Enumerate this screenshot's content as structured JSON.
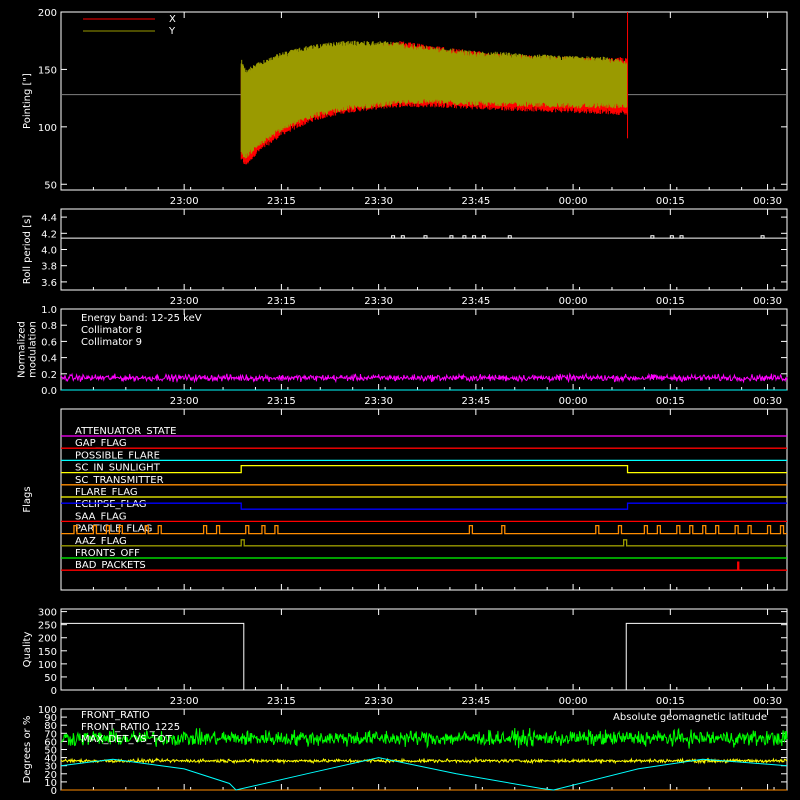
{
  "time_axis": {
    "unit": "HH:MM",
    "range_minutes": [
      -19,
      93
    ],
    "ticks": [
      {
        "m": 0,
        "label": "23:00"
      },
      {
        "m": 15,
        "label": "23:15"
      },
      {
        "m": 30,
        "label": "23:30"
      },
      {
        "m": 45,
        "label": "23:45"
      },
      {
        "m": 60,
        "label": "00:00"
      },
      {
        "m": 75,
        "label": "00:15"
      },
      {
        "m": 90,
        "label": "00:30"
      }
    ],
    "data_gap_minutes": [
      8.8,
      68.4
    ]
  },
  "colors": {
    "white": "#ffffff",
    "red": "#ff0000",
    "olive": "#9a9a00",
    "cyan": "#00ffff",
    "magenta": "#ff00ff",
    "gray": "#808080",
    "green": "#00ff00",
    "yellow": "#ffff00",
    "orange": "#ff8c00",
    "blue": "#0000ff",
    "brightgreen": "#33ff33"
  },
  "chart_data": [
    {
      "type": "line",
      "name": "pointing",
      "ylabel": "Pointing [\"]",
      "ylim": [
        45,
        200
      ],
      "yticks": [
        50,
        100,
        150,
        200
      ],
      "reference_line": 128,
      "legend": {
        "placement": "top-left",
        "entries": [
          {
            "label": "X",
            "color": "red"
          },
          {
            "label": "Y",
            "color": "olive"
          }
        ]
      },
      "series": [
        {
          "name": "X",
          "color": "red",
          "envelope_x_minutes": [
            8.8,
            9.5,
            11,
            15,
            20,
            25,
            30,
            33,
            38,
            45,
            50,
            55,
            60,
            65,
            68.4
          ],
          "upper": [
            155,
            146,
            151,
            158,
            165,
            170,
            172,
            175,
            171,
            166,
            163,
            162,
            161,
            160,
            161
          ],
          "lower": [
            70,
            65,
            75,
            92,
            105,
            112,
            115,
            117,
            117,
            115,
            114,
            113,
            112,
            111,
            110
          ]
        },
        {
          "name": "Y",
          "color": "olive",
          "envelope_x_minutes": [
            8.8,
            9.5,
            11,
            15,
            20,
            25,
            30,
            33,
            38,
            45,
            50,
            55,
            60,
            65,
            68.4
          ],
          "upper": [
            160,
            150,
            155,
            165,
            172,
            175,
            175,
            174,
            170,
            166,
            165,
            163,
            162,
            161,
            158
          ],
          "lower": [
            75,
            72,
            80,
            96,
            108,
            114,
            117,
            119,
            120,
            118,
            118,
            117,
            116,
            116,
            116
          ]
        }
      ]
    },
    {
      "type": "line",
      "name": "roll",
      "ylabel": "Roll period [s]",
      "ylim": [
        3.5,
        4.5
      ],
      "yticks": [
        3.6,
        3.8,
        4.0,
        4.2,
        4.4
      ],
      "series": [
        {
          "name": "",
          "color": "white",
          "baseline": 4.14,
          "blips_minutes": [
            32,
            33.5,
            37,
            41,
            43,
            44.5,
            46,
            50,
            72,
            75,
            76.5,
            89
          ]
        }
      ]
    },
    {
      "type": "line",
      "name": "modulation",
      "ylabel_lines": [
        "Normalized",
        "modulation"
      ],
      "ylim": [
        0,
        1
      ],
      "yticks": [
        0.0,
        0.2,
        0.4,
        0.6,
        0.8,
        1.0
      ],
      "legend": {
        "placement": "top-left",
        "entries": [
          {
            "label": "Energy band: 12-25 keV",
            "color": "white"
          },
          {
            "label": "Collimator 8",
            "color": "cyan"
          },
          {
            "label": "Collimator 9",
            "color": "magenta"
          }
        ]
      },
      "series": [
        {
          "name": "Collimator 9",
          "color": "magenta",
          "mean": 0.15,
          "spread": 0.06
        },
        {
          "name": "Collimator 8",
          "color": "cyan",
          "mean": 0.0,
          "spread": 0.0
        }
      ]
    },
    {
      "type": "step",
      "name": "flags",
      "ylabel": "Flags",
      "flags": [
        {
          "label": "ATTENUATOR_STATE",
          "color": "magenta",
          "mode": "flat"
        },
        {
          "label": "GAP_FLAG",
          "color": "red",
          "mode": "flat"
        },
        {
          "label": "POSSIBLE_FLARE",
          "color": "cyan",
          "mode": "flat"
        },
        {
          "label": "SC_IN_SUNLIGHT",
          "color": "yellow",
          "mode": "sunlight"
        },
        {
          "label": "SC_TRANSMITTER",
          "color": "orange",
          "mode": "flat"
        },
        {
          "label": "FLARE_FLAG",
          "color": "yellow",
          "mode": "flat"
        },
        {
          "label": "ECLIPSE_FLAG",
          "color": "blue",
          "mode": "eclipse"
        },
        {
          "label": "SAA_FLAG",
          "color": "red",
          "mode": "flat"
        },
        {
          "label": "PARTICLE_FLAG",
          "color": "orange",
          "mode": "particle",
          "pulses_minutes": [
            -17,
            -14,
            -12,
            -10,
            -6,
            -4,
            3,
            5,
            9.5,
            12,
            14,
            44,
            49,
            63.5,
            67,
            71,
            73,
            76,
            78,
            80,
            82,
            85,
            87,
            90,
            92
          ]
        },
        {
          "label": "AAZ_FLAG",
          "color": "olive",
          "mode": "aaz",
          "pulses_minutes": [
            8.8,
            67.8
          ]
        },
        {
          "label": "FRONTS_OFF",
          "color": "green",
          "mode": "flat"
        },
        {
          "label": "BAD_PACKETS",
          "color": "red",
          "mode": "badpackets",
          "pulses_minutes": [
            85.4
          ]
        }
      ]
    },
    {
      "type": "step",
      "name": "quality",
      "ylabel": "Quality",
      "ylim": [
        0,
        310
      ],
      "yticks": [
        0,
        50,
        100,
        150,
        200,
        250,
        300
      ],
      "series": [
        {
          "name": "",
          "color": "white",
          "steps": [
            {
              "m": -19,
              "v": 255
            },
            {
              "m": 9.2,
              "v": 0
            },
            {
              "m": 68.2,
              "v": 255
            }
          ]
        }
      ]
    },
    {
      "type": "line",
      "name": "degrees",
      "ylabel": "Degrees or %",
      "ylim": [
        0,
        100
      ],
      "yticks": [
        0,
        10,
        20,
        30,
        40,
        50,
        60,
        70,
        80,
        90,
        100
      ],
      "legend": {
        "placement": "top-left",
        "entries": [
          {
            "label": "FRONT_RATIO",
            "color": "yellow"
          },
          {
            "label": "FRONT_RATIO_1225",
            "color": "green"
          },
          {
            "label": "MAX_DET_VS_TOT",
            "color": "orange"
          }
        ]
      },
      "annotation": {
        "label": "Absolute geomagnetic latitude",
        "color": "cyan",
        "placement": "top-right"
      },
      "series": [
        {
          "name": "FRONT_RATIO_1225",
          "color": "green",
          "mean": 64,
          "spread": 14
        },
        {
          "name": "FRONT_RATIO",
          "color": "yellow",
          "mean": 36,
          "spread": 3
        },
        {
          "name": "MAX_DET_VS_TOT",
          "color": "orange",
          "mean": 0,
          "spread": 0
        },
        {
          "name": "Absolute geomagnetic latitude",
          "color": "cyan",
          "x_minutes": [
            -19,
            -11,
            0,
            7,
            8,
            20,
            30,
            42,
            55,
            57,
            70,
            80,
            93
          ],
          "y": [
            30,
            38,
            26,
            8,
            0,
            22,
            40,
            20,
            2,
            0,
            26,
            38,
            30
          ]
        }
      ]
    }
  ]
}
